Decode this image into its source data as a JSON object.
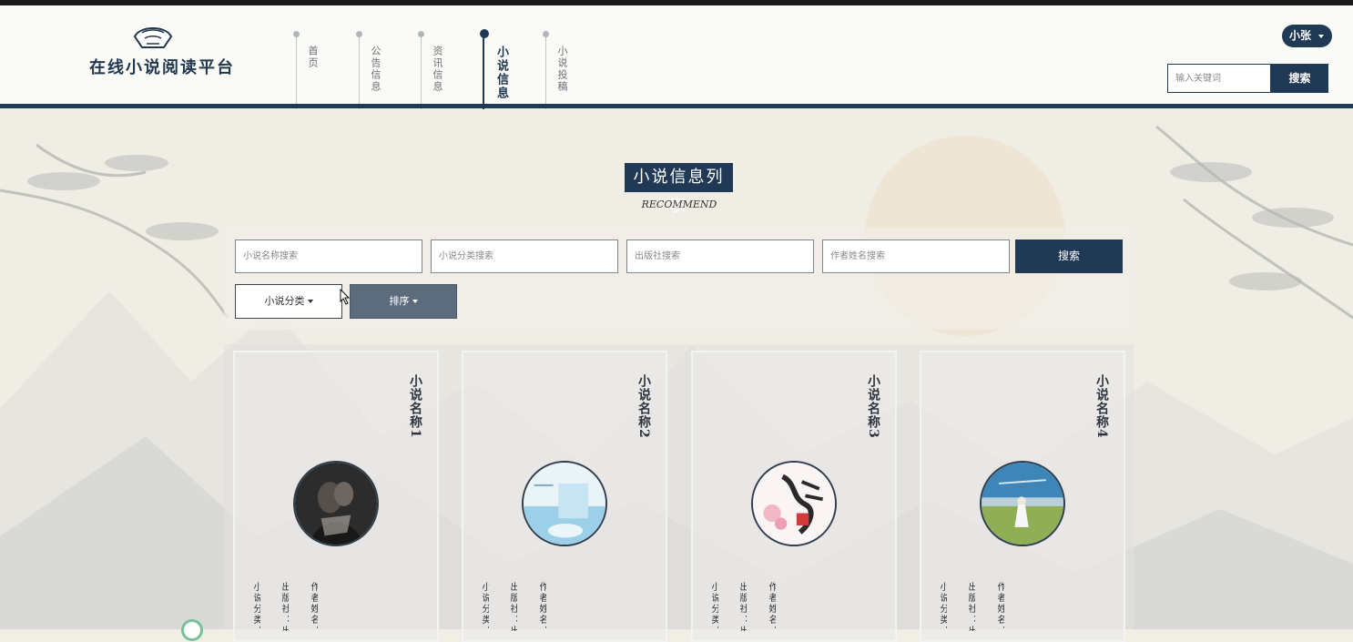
{
  "brand": {
    "title": "在线小说阅读平台",
    "logo_icon": "fan-logo-icon"
  },
  "nav": {
    "items": [
      {
        "label": "首页",
        "active": false
      },
      {
        "label": "公告信息",
        "active": false
      },
      {
        "label": "资讯信息",
        "active": false
      },
      {
        "label": "小说信息",
        "active": true
      },
      {
        "label": "小说投稿",
        "active": false
      }
    ]
  },
  "user": {
    "name": "小张"
  },
  "top_search": {
    "placeholder": "输入关键词",
    "button_label": "搜索"
  },
  "section": {
    "title": "小说信息列表",
    "subtitle": "RECOMMEND"
  },
  "filters": {
    "name_placeholder": "小说名称搜索",
    "category_placeholder": "小说分类搜索",
    "publisher_placeholder": "出版社搜索",
    "author_placeholder": "作者姓名搜索",
    "search_label": "搜索",
    "category_dropdown": "小说分类",
    "sort_dropdown": "排序"
  },
  "cards": [
    {
      "name": "小说名称1",
      "category": "小说分类：",
      "publisher": "出版社：出",
      "author": "作者姓名："
    },
    {
      "name": "小说名称2",
      "category": "小说分类：",
      "publisher": "出版社：出",
      "author": "作者姓名："
    },
    {
      "name": "小说名称3",
      "category": "小说分类：",
      "publisher": "出版社：出",
      "author": "作者姓名："
    },
    {
      "name": "小说名称4",
      "category": "小说分类：",
      "publisher": "出版社：出",
      "author": "作者姓名："
    }
  ],
  "colors": {
    "primary": "#203a56",
    "sort_button": "#5d6c7c",
    "background": "#f1eee6"
  }
}
